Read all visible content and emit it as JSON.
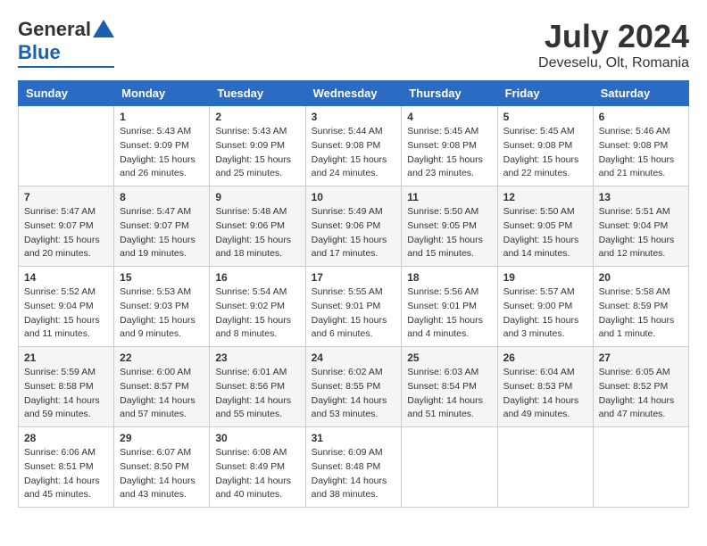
{
  "header": {
    "logo_general": "General",
    "logo_blue": "Blue",
    "title": "July 2024",
    "subtitle": "Deveselu, Olt, Romania"
  },
  "days_of_week": [
    "Sunday",
    "Monday",
    "Tuesday",
    "Wednesday",
    "Thursday",
    "Friday",
    "Saturday"
  ],
  "weeks": [
    [
      {
        "day": "",
        "info": ""
      },
      {
        "day": "1",
        "info": "Sunrise: 5:43 AM\nSunset: 9:09 PM\nDaylight: 15 hours\nand 26 minutes."
      },
      {
        "day": "2",
        "info": "Sunrise: 5:43 AM\nSunset: 9:09 PM\nDaylight: 15 hours\nand 25 minutes."
      },
      {
        "day": "3",
        "info": "Sunrise: 5:44 AM\nSunset: 9:08 PM\nDaylight: 15 hours\nand 24 minutes."
      },
      {
        "day": "4",
        "info": "Sunrise: 5:45 AM\nSunset: 9:08 PM\nDaylight: 15 hours\nand 23 minutes."
      },
      {
        "day": "5",
        "info": "Sunrise: 5:45 AM\nSunset: 9:08 PM\nDaylight: 15 hours\nand 22 minutes."
      },
      {
        "day": "6",
        "info": "Sunrise: 5:46 AM\nSunset: 9:08 PM\nDaylight: 15 hours\nand 21 minutes."
      }
    ],
    [
      {
        "day": "7",
        "info": "Sunrise: 5:47 AM\nSunset: 9:07 PM\nDaylight: 15 hours\nand 20 minutes."
      },
      {
        "day": "8",
        "info": "Sunrise: 5:47 AM\nSunset: 9:07 PM\nDaylight: 15 hours\nand 19 minutes."
      },
      {
        "day": "9",
        "info": "Sunrise: 5:48 AM\nSunset: 9:06 PM\nDaylight: 15 hours\nand 18 minutes."
      },
      {
        "day": "10",
        "info": "Sunrise: 5:49 AM\nSunset: 9:06 PM\nDaylight: 15 hours\nand 17 minutes."
      },
      {
        "day": "11",
        "info": "Sunrise: 5:50 AM\nSunset: 9:05 PM\nDaylight: 15 hours\nand 15 minutes."
      },
      {
        "day": "12",
        "info": "Sunrise: 5:50 AM\nSunset: 9:05 PM\nDaylight: 15 hours\nand 14 minutes."
      },
      {
        "day": "13",
        "info": "Sunrise: 5:51 AM\nSunset: 9:04 PM\nDaylight: 15 hours\nand 12 minutes."
      }
    ],
    [
      {
        "day": "14",
        "info": "Sunrise: 5:52 AM\nSunset: 9:04 PM\nDaylight: 15 hours\nand 11 minutes."
      },
      {
        "day": "15",
        "info": "Sunrise: 5:53 AM\nSunset: 9:03 PM\nDaylight: 15 hours\nand 9 minutes."
      },
      {
        "day": "16",
        "info": "Sunrise: 5:54 AM\nSunset: 9:02 PM\nDaylight: 15 hours\nand 8 minutes."
      },
      {
        "day": "17",
        "info": "Sunrise: 5:55 AM\nSunset: 9:01 PM\nDaylight: 15 hours\nand 6 minutes."
      },
      {
        "day": "18",
        "info": "Sunrise: 5:56 AM\nSunset: 9:01 PM\nDaylight: 15 hours\nand 4 minutes."
      },
      {
        "day": "19",
        "info": "Sunrise: 5:57 AM\nSunset: 9:00 PM\nDaylight: 15 hours\nand 3 minutes."
      },
      {
        "day": "20",
        "info": "Sunrise: 5:58 AM\nSunset: 8:59 PM\nDaylight: 15 hours\nand 1 minute."
      }
    ],
    [
      {
        "day": "21",
        "info": "Sunrise: 5:59 AM\nSunset: 8:58 PM\nDaylight: 14 hours\nand 59 minutes."
      },
      {
        "day": "22",
        "info": "Sunrise: 6:00 AM\nSunset: 8:57 PM\nDaylight: 14 hours\nand 57 minutes."
      },
      {
        "day": "23",
        "info": "Sunrise: 6:01 AM\nSunset: 8:56 PM\nDaylight: 14 hours\nand 55 minutes."
      },
      {
        "day": "24",
        "info": "Sunrise: 6:02 AM\nSunset: 8:55 PM\nDaylight: 14 hours\nand 53 minutes."
      },
      {
        "day": "25",
        "info": "Sunrise: 6:03 AM\nSunset: 8:54 PM\nDaylight: 14 hours\nand 51 minutes."
      },
      {
        "day": "26",
        "info": "Sunrise: 6:04 AM\nSunset: 8:53 PM\nDaylight: 14 hours\nand 49 minutes."
      },
      {
        "day": "27",
        "info": "Sunrise: 6:05 AM\nSunset: 8:52 PM\nDaylight: 14 hours\nand 47 minutes."
      }
    ],
    [
      {
        "day": "28",
        "info": "Sunrise: 6:06 AM\nSunset: 8:51 PM\nDaylight: 14 hours\nand 45 minutes."
      },
      {
        "day": "29",
        "info": "Sunrise: 6:07 AM\nSunset: 8:50 PM\nDaylight: 14 hours\nand 43 minutes."
      },
      {
        "day": "30",
        "info": "Sunrise: 6:08 AM\nSunset: 8:49 PM\nDaylight: 14 hours\nand 40 minutes."
      },
      {
        "day": "31",
        "info": "Sunrise: 6:09 AM\nSunset: 8:48 PM\nDaylight: 14 hours\nand 38 minutes."
      },
      {
        "day": "",
        "info": ""
      },
      {
        "day": "",
        "info": ""
      },
      {
        "day": "",
        "info": ""
      }
    ]
  ]
}
